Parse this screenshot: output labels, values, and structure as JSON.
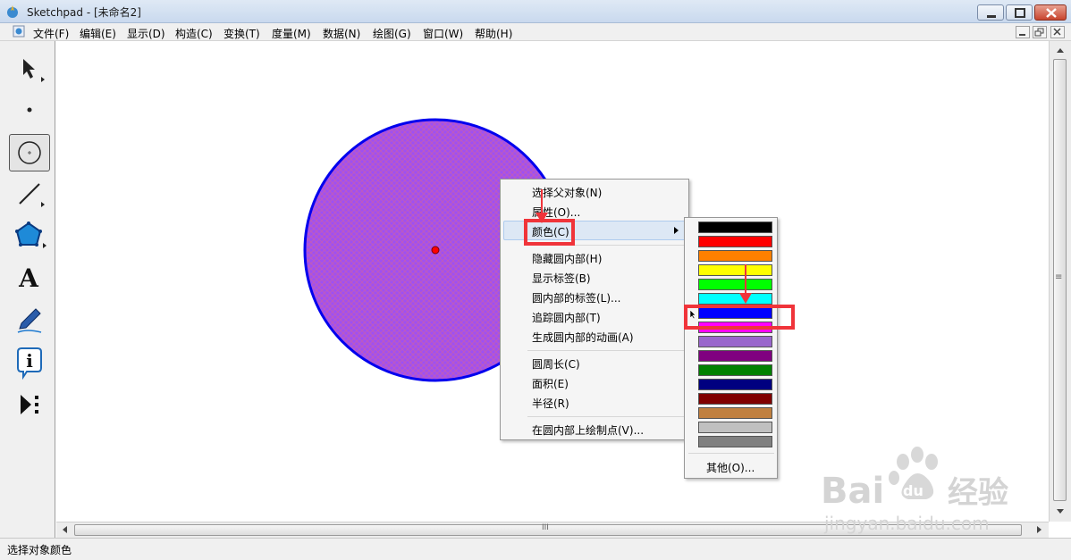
{
  "window": {
    "app_name": "Sketchpad",
    "title": "Sketchpad  - [未命名2]"
  },
  "menubar": {
    "items": [
      "文件(F)",
      "编辑(E)",
      "显示(D)",
      "构造(C)",
      "变换(T)",
      "度量(M)",
      "数据(N)",
      "绘图(G)",
      "窗口(W)",
      "帮助(H)"
    ]
  },
  "toolbox": {
    "tools": [
      "arrow-select-tool",
      "point-tool",
      "compass-tool",
      "straightedge-tool",
      "polygon-tool",
      "text-tool",
      "marker-tool",
      "info-tool",
      "custom-tool"
    ],
    "text_tool_glyph": "A",
    "info_tool_glyph": "i",
    "selected": "compass-tool"
  },
  "context_menu": {
    "items": [
      "选择父对象(N)",
      "属性(O)...",
      "颜色(C)",
      "隐藏圆内部(H)",
      "显示标签(B)",
      "圆内部的标签(L)...",
      "追踪圆内部(T)",
      "生成圆内部的动画(A)",
      "圆周长(C)",
      "面积(E)",
      "半径(R)",
      "在圆内部上绘制点(V)..."
    ],
    "highlighted": "颜色(C)"
  },
  "color_submenu": {
    "swatches": [
      "#000000",
      "#ff0000",
      "#ff8000",
      "#ffff00",
      "#00ff00",
      "#00ffff",
      "#0000ff",
      "#ff00ff",
      "#9966cc",
      "#800080",
      "#008000",
      "#000080",
      "#800000",
      "#c08040",
      "#c0c0c0",
      "#808080"
    ],
    "selected_color": "#0000ff",
    "other_label": "其他(O)..."
  },
  "canvas": {
    "circle_fill": "#a050f0",
    "circle_stroke": "#0000ee",
    "center_point_color": "#ff0000"
  },
  "status": {
    "text": "选择对象颜色"
  },
  "scrollbars": {
    "h_grip": "III",
    "v_grip": "≡"
  },
  "watermark": {
    "brand": "Bai",
    "paw": "du",
    "cn": "经验",
    "url": "jingyan.baidu.com"
  },
  "annotation_color": "#f0343a"
}
